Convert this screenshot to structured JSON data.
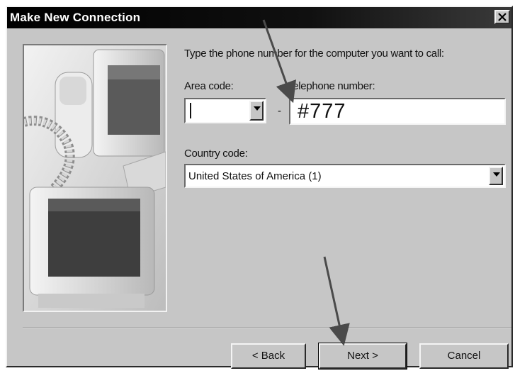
{
  "window": {
    "title": "Make New Connection",
    "close_glyph": "×"
  },
  "instruction": "Type the phone number for the computer you want to call:",
  "area_code": {
    "label": "Area code:",
    "value": ""
  },
  "separator_dash": "-",
  "telephone": {
    "label": "Telephone number:",
    "value": "#777"
  },
  "country": {
    "label": "Country code:",
    "value": "United States of America (1)"
  },
  "buttons": {
    "back": "< Back",
    "next": "Next >",
    "cancel": "Cancel"
  },
  "icons": {
    "close": "close-icon",
    "dropdown": "chevron-down-icon",
    "illustration": "computer-phone-illustration"
  },
  "colors": {
    "dialog_bg": "#c6c6c6",
    "titlebar": "#000000",
    "annotation_arrow": "#4a4a4a"
  }
}
